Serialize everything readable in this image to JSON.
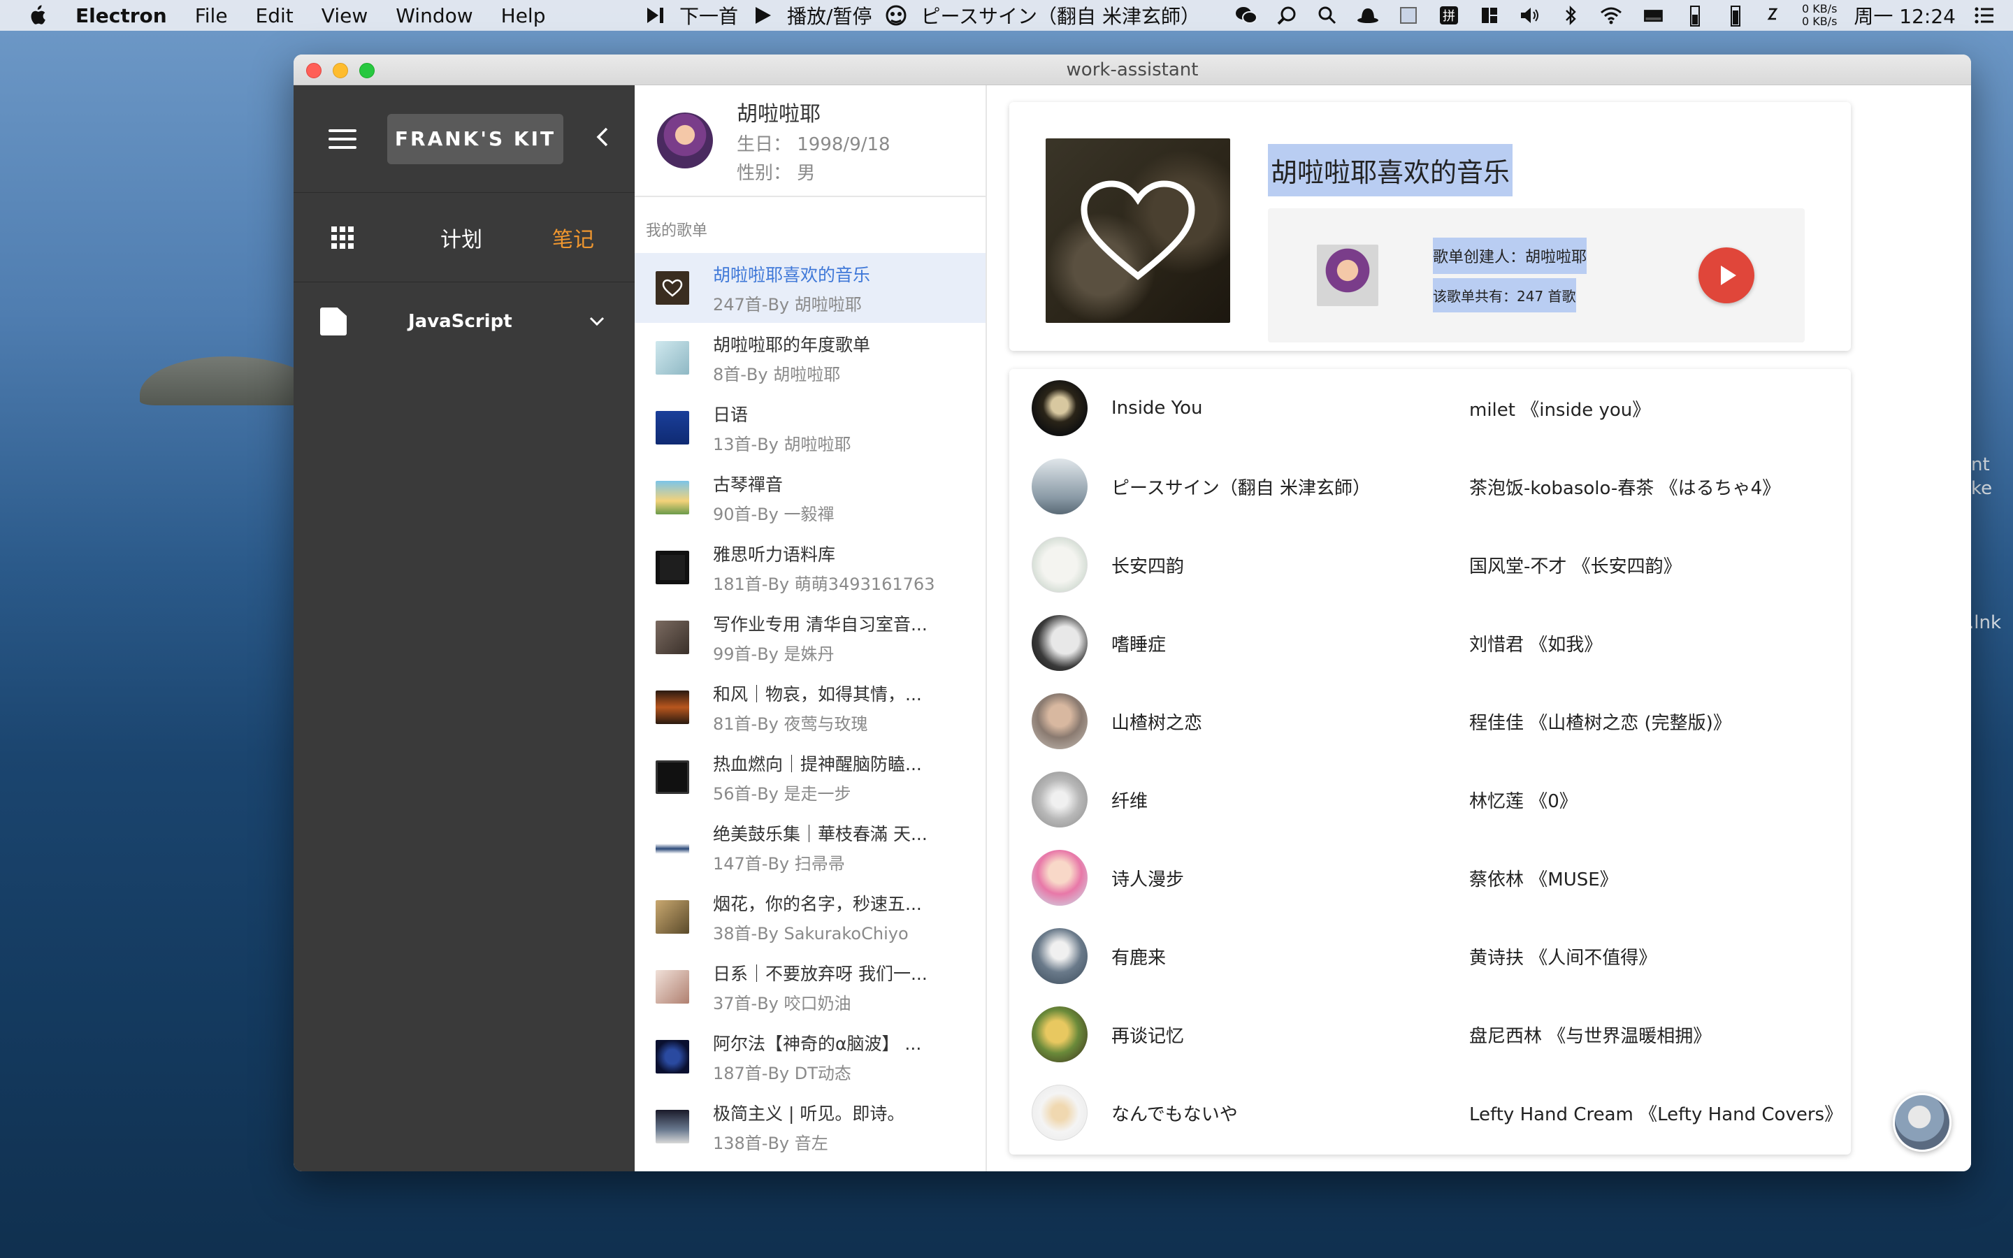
{
  "menubar": {
    "app_name": "Electron",
    "menus": [
      "File",
      "Edit",
      "View",
      "Window",
      "Help"
    ],
    "next_label": "下一首",
    "playpause_label": "播放/暂停",
    "now_playing": "ピースサイン（翻自 米津玄師）",
    "net_up": "0 KB/s",
    "net_down": "0 KB/s",
    "clock": "周一 12:24"
  },
  "desktop": {
    "edge_label_1": "nt",
    "edge_label_2": "ke",
    "edge_label_3": ".lnk"
  },
  "window": {
    "title": "work-assistant"
  },
  "sidebar": {
    "brand": "FRANK'S KIT",
    "nav_plan": "计划",
    "nav_notes": "笔记",
    "category": "JavaScript",
    "active_color": "#f0972f"
  },
  "profile": {
    "name": "胡啦啦耶",
    "birthday": "生日：  1998/9/18",
    "gender": "性别：  男"
  },
  "playlists": {
    "heading": "我的歌单",
    "items": [
      {
        "title": "胡啦啦耶喜欢的音乐",
        "sub": "247首-By 胡啦啦耶"
      },
      {
        "title": "胡啦啦耶的年度歌单",
        "sub": "8首-By 胡啦啦耶"
      },
      {
        "title": "日语",
        "sub": "13首-By 胡啦啦耶"
      },
      {
        "title": "古琴禪音",
        "sub": "90首-By 一毅禪"
      },
      {
        "title": "雅思听力语料库",
        "sub": "181首-By 萌萌3493161763"
      },
      {
        "title": "写作业专用 清华自习室音...",
        "sub": "99首-By 是姝丹"
      },
      {
        "title": "和风｜物哀，如得其情，...",
        "sub": "81首-By 夜莺与玫瑰"
      },
      {
        "title": "热血燃向｜提神醒脑防瞌...",
        "sub": "56首-By 是走一步"
      },
      {
        "title": "绝美鼓乐集｜華枝春滿 天...",
        "sub": "147首-By 扫帚帚"
      },
      {
        "title": "烟花，你的名字，秒速五...",
        "sub": "38首-By SakurakoChiyo"
      },
      {
        "title": "日系｜不要放弃呀 我们一...",
        "sub": "37首-By 咬口奶油"
      },
      {
        "title": "阿尔法【神奇的α脑波】 ...",
        "sub": "187首-By DT动态"
      },
      {
        "title": "极简主义 | 听见。即诗。",
        "sub": "138首-By 音左"
      }
    ]
  },
  "detail": {
    "title": "胡啦啦耶喜欢的音乐",
    "creator": "歌单创建人：胡啦啦耶",
    "count": "该歌单共有：247 首歌",
    "accent": "#e0463a"
  },
  "songs": [
    {
      "name": "Inside You",
      "artist": "milet 《inside you》"
    },
    {
      "name": "ピースサイン（翻自 米津玄師）",
      "artist": "茶泡饭-kobasolo-春茶 《はるちゃ4》"
    },
    {
      "name": "长安四韵",
      "artist": "国风堂-不才 《长安四韵》"
    },
    {
      "name": "嗜睡症",
      "artist": "刘惜君 《如我》"
    },
    {
      "name": "山楂树之恋",
      "artist": "程佳佳 《山楂树之恋 (完整版)》"
    },
    {
      "name": "纤维",
      "artist": "林忆莲 《0》"
    },
    {
      "name": "诗人漫步",
      "artist": "蔡依林 《MUSE》"
    },
    {
      "name": "有鹿来",
      "artist": "黄诗扶 《人间不值得》"
    },
    {
      "name": "再谈记忆",
      "artist": "盘尼西林 《与世界温暖相拥》"
    },
    {
      "name": "なんでもないや",
      "artist": "Lefty Hand Cream 《Lefty Hand Covers》"
    }
  ]
}
